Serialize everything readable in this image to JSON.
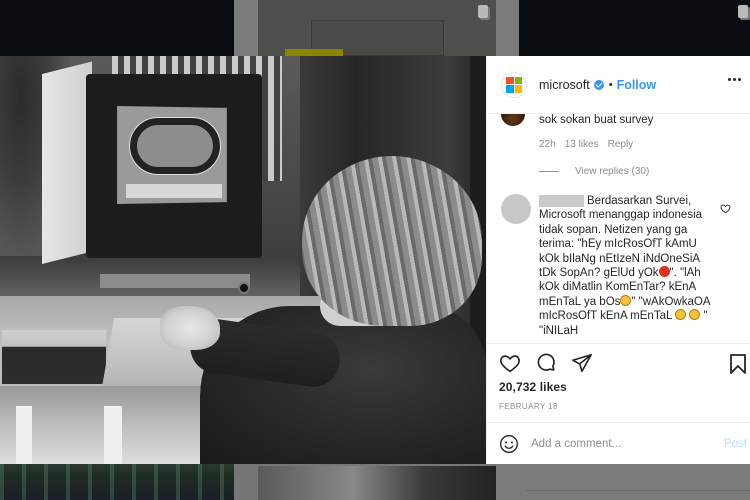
{
  "post": {
    "account": {
      "username": "microsoft",
      "verified": true,
      "separator": "•",
      "follow_label": "Follow",
      "avatar_icon": "microsoft-logo-icon",
      "logo_colors": [
        "#f25022",
        "#7fba00",
        "#00a4ef",
        "#ffb900"
      ]
    },
    "more_icon": "more-options-icon",
    "comments": [
      {
        "text": "sok sokan buat survey",
        "time": "22h",
        "likes": "13 likes",
        "reply_label": "Reply",
        "view_replies_label": "View replies (30)"
      },
      {
        "username_redacted": true,
        "text_part1": "Berdasarkan Survei, Microsoft menanggap indonesia tidak sopan. Netizen yang ga terima: \"hEy mIcRosOfT kAmU kOk bIlaNg nEtIzeN iNdOneSiA tDk SopAn? gElUd yOk",
        "text_part2": "\". \"lAh kOk diMatlin KomEnTar? kEnA mEnTaL ya bOs",
        "text_part3": "\" \"wAkOwkaOA mIcRosOfT kEnA mEnTaL ",
        "text_part4": " \" \"iNILaH",
        "like_icon": "heart-outline-icon"
      }
    ],
    "actions": {
      "like_icon": "heart-icon",
      "comment_icon": "comment-icon",
      "share_icon": "share-icon",
      "save_icon": "bookmark-icon"
    },
    "likes_count": "20,732 likes",
    "date": "FEBRUARY 18",
    "add_comment": {
      "placeholder": "Add a comment...",
      "value": "",
      "post_label": "Post",
      "emoji_icon": "emoji-icon"
    },
    "colors": {
      "accent": "#3897f0",
      "post_disabled": "#b2dffc",
      "secondary_text": "#8e8e8e",
      "primary_text": "#262626"
    }
  }
}
